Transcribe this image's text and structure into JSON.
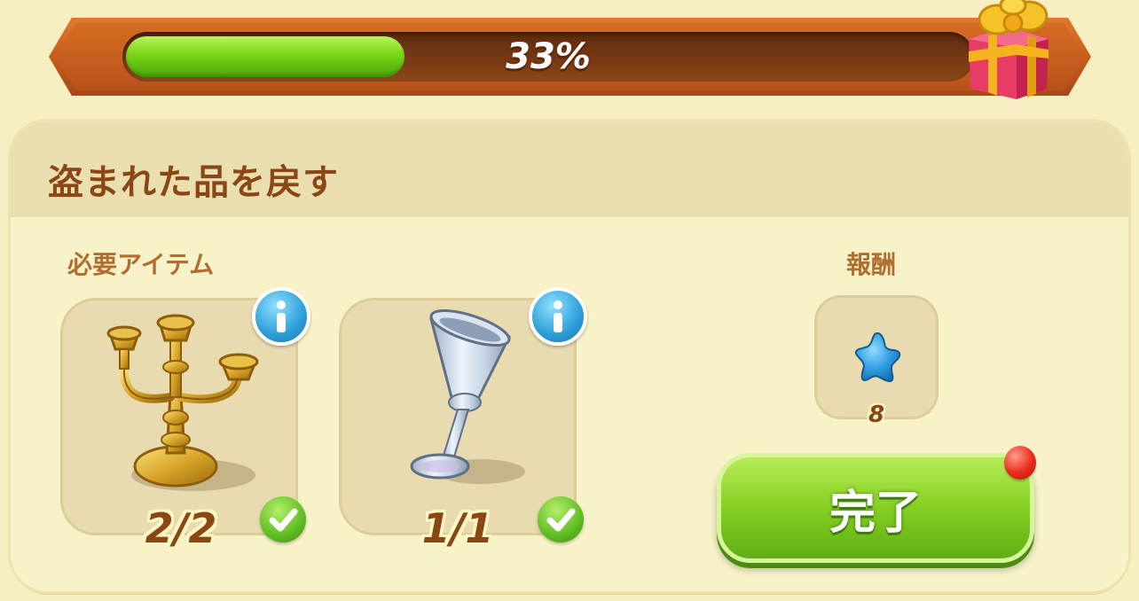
{
  "progress": {
    "value": 0.33,
    "label": "33%",
    "gift_icon": "gift-box-icon"
  },
  "quest": {
    "title": "盗まれた品を戻す",
    "required_label": "必要アイテム",
    "reward_label": "報酬",
    "items": [
      {
        "icon": "candelabra-icon",
        "count": "2/2",
        "complete": true,
        "info_icon": "info-icon",
        "check_icon": "checkmark-icon"
      },
      {
        "icon": "silver-goblet-icon",
        "count": "1/1",
        "complete": true,
        "info_icon": "info-icon",
        "check_icon": "checkmark-icon"
      }
    ],
    "reward": {
      "icon": "blue-star-icon",
      "amount": "8"
    },
    "complete_button": "完了",
    "notification_dot": "notification-dot-icon"
  },
  "colors": {
    "progress_fill": "#79d516",
    "banner": "#c55a1c",
    "title_text": "#8a4715",
    "label_text": "#b06f31",
    "button_green": "#86cf22",
    "info_blue": "#2d9ed8",
    "background": "#f7efc2"
  }
}
